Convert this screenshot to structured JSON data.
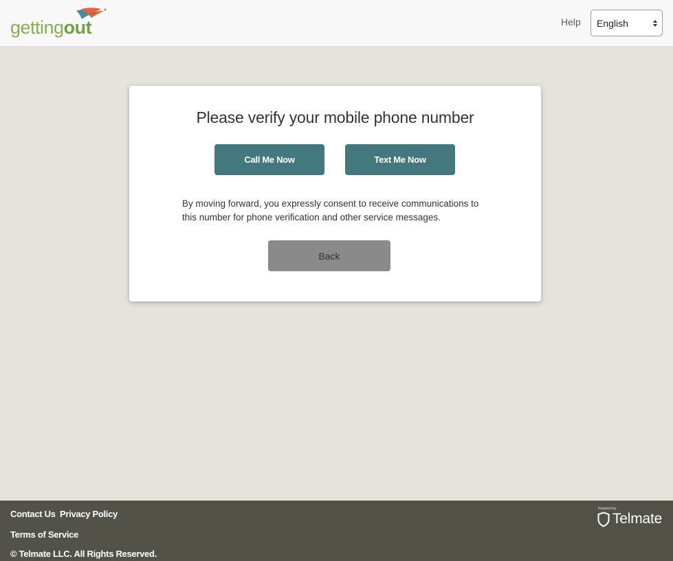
{
  "header": {
    "logo": {
      "text_light": "getting",
      "text_bold": "out",
      "icon": "gettingout-logo-mark"
    },
    "help_label": "Help",
    "language": {
      "selected": "English",
      "options": [
        "English"
      ]
    }
  },
  "card": {
    "title": "Please verify your mobile phone number",
    "call_button_label": "Call Me Now",
    "text_button_label": "Text Me Now",
    "consent_text": "By moving forward, you expressly consent to receive communications to this number for phone verification and other service messages.",
    "back_button_label": "Back"
  },
  "footer": {
    "links": {
      "contact": "Contact Us",
      "privacy": "Privacy Policy",
      "terms": "Terms of Service"
    },
    "copyright": "© Telmate LLC. All Rights Reserved.",
    "brand": {
      "powered_by": "Powered by",
      "name": "Telmate",
      "icon": "shield-icon"
    }
  },
  "colors": {
    "header_bg": "#f8f8f8",
    "page_bg": "#e6e2dc",
    "primary_button": "#44787f",
    "back_button": "#8a8a8b",
    "footer_bg": "#535248",
    "logo_green": "#86b04e"
  }
}
